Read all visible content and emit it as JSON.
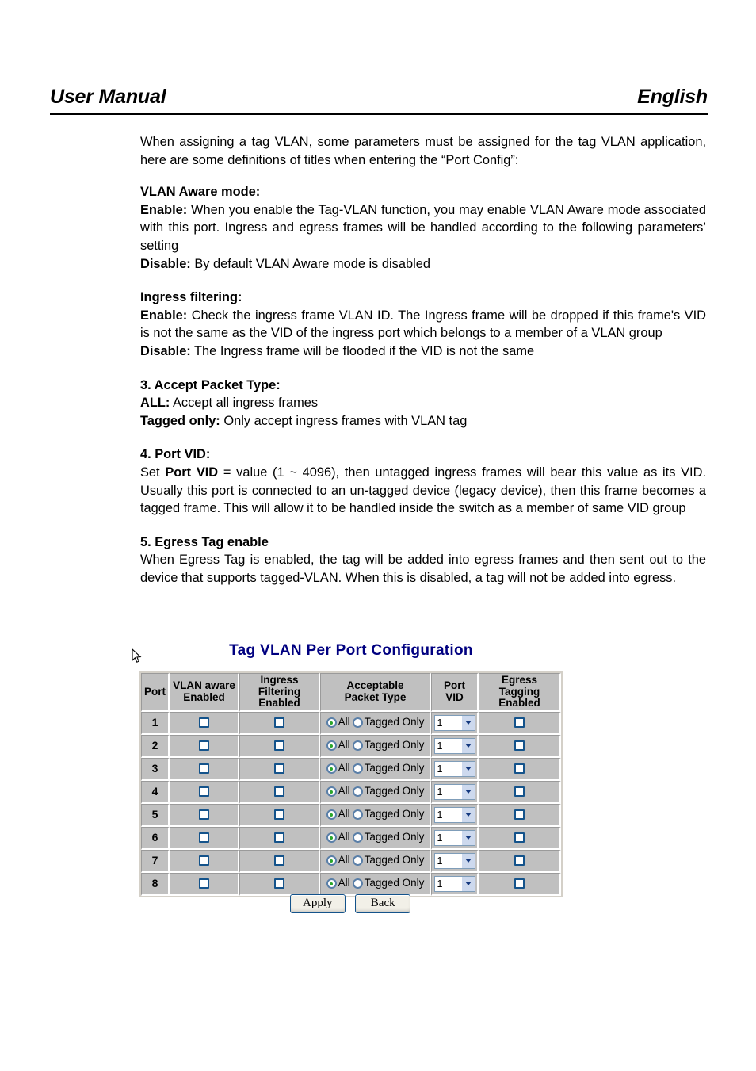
{
  "header": {
    "left": "User Manual",
    "right": "English"
  },
  "body": {
    "intro": "When assigning a tag VLAN, some parameters must be assigned for the tag VLAN application, here are some definitions of titles when entering the “Port Config”:",
    "sections": [
      {
        "heading": "VLAN Aware mode:",
        "lines": [
          {
            "term": "Enable:",
            "text": " When you enable the Tag-VLAN function, you may enable VLAN Aware mode associated with this port. Ingress and egress frames will be handled according to the following parameters’ setting"
          },
          {
            "term": "Disable:",
            "text": " By default VLAN Aware mode is disabled"
          }
        ]
      },
      {
        "heading": "Ingress filtering:",
        "lines": [
          {
            "term": "Enable:",
            "text": " Check the ingress frame VLAN ID. The Ingress frame will be dropped if this frame's VID is not the same as the VID of the ingress port which belongs to a member of a VLAN group"
          },
          {
            "term": "Disable:",
            "text": " The Ingress frame will be flooded if the VID is not the same"
          }
        ]
      },
      {
        "heading": "3. Accept Packet Type:",
        "lines": [
          {
            "term": "ALL:",
            "text": " Accept all ingress frames"
          },
          {
            "term": "Tagged only:",
            "text": " Only accept ingress frames with VLAN tag"
          }
        ]
      },
      {
        "heading": "4. Port VID:",
        "lines": [
          {
            "term": "",
            "text": "Set "
          },
          {
            "term": "",
            "text": ""
          }
        ]
      },
      {
        "heading": "5. Egress Tag enable",
        "lines": [
          {
            "term": "",
            "text": "When Egress Tag is enabled, the tag will be added into egress frames and then sent out to the device that supports tagged-VLAN. When this is disabled, a tag will not be added into egress."
          }
        ]
      }
    ],
    "port_vid_body": {
      "prefix": "Set ",
      "bold": "Port VID",
      "rest": " = value (1 ~ 4096), then untagged ingress frames will bear this value as its VID. Usually this port is connected to an un-tagged device (legacy device), then this frame becomes a tagged frame. This will allow it to be handled inside the switch as a member of same VID group"
    }
  },
  "ui": {
    "title": "Tag VLAN Per Port Configuration",
    "title_color": "#000080",
    "columns": [
      "Port",
      "VLAN aware Enabled",
      "Ingress Filtering Enabled",
      "Acceptable Packet Type",
      "Port VID",
      "Egress Tagging Enabled"
    ],
    "column_lines": [
      [
        "Port"
      ],
      [
        "VLAN aware",
        "Enabled"
      ],
      [
        "Ingress Filtering",
        "Enabled"
      ],
      [
        "Acceptable",
        "Packet Type"
      ],
      [
        "Port VID"
      ],
      [
        "Egress Tagging",
        "Enabled"
      ]
    ],
    "packet_type_options": [
      "All",
      "Tagged Only"
    ],
    "rows": [
      {
        "port": "1",
        "vlan_aware_enabled": false,
        "ingress_filtering_enabled": false,
        "acceptable_packet_type": "All",
        "port_vid": "1",
        "egress_tagging_enabled": false
      },
      {
        "port": "2",
        "vlan_aware_enabled": false,
        "ingress_filtering_enabled": false,
        "acceptable_packet_type": "All",
        "port_vid": "1",
        "egress_tagging_enabled": false
      },
      {
        "port": "3",
        "vlan_aware_enabled": false,
        "ingress_filtering_enabled": false,
        "acceptable_packet_type": "All",
        "port_vid": "1",
        "egress_tagging_enabled": false
      },
      {
        "port": "4",
        "vlan_aware_enabled": false,
        "ingress_filtering_enabled": false,
        "acceptable_packet_type": "All",
        "port_vid": "1",
        "egress_tagging_enabled": false
      },
      {
        "port": "5",
        "vlan_aware_enabled": false,
        "ingress_filtering_enabled": false,
        "acceptable_packet_type": "All",
        "port_vid": "1",
        "egress_tagging_enabled": false
      },
      {
        "port": "6",
        "vlan_aware_enabled": false,
        "ingress_filtering_enabled": false,
        "acceptable_packet_type": "All",
        "port_vid": "1",
        "egress_tagging_enabled": false
      },
      {
        "port": "7",
        "vlan_aware_enabled": false,
        "ingress_filtering_enabled": false,
        "acceptable_packet_type": "All",
        "port_vid": "1",
        "egress_tagging_enabled": false
      },
      {
        "port": "8",
        "vlan_aware_enabled": false,
        "ingress_filtering_enabled": false,
        "acceptable_packet_type": "All",
        "port_vid": "1",
        "egress_tagging_enabled": false
      }
    ],
    "buttons": [
      {
        "label": "Apply"
      },
      {
        "label": "Back"
      }
    ]
  }
}
